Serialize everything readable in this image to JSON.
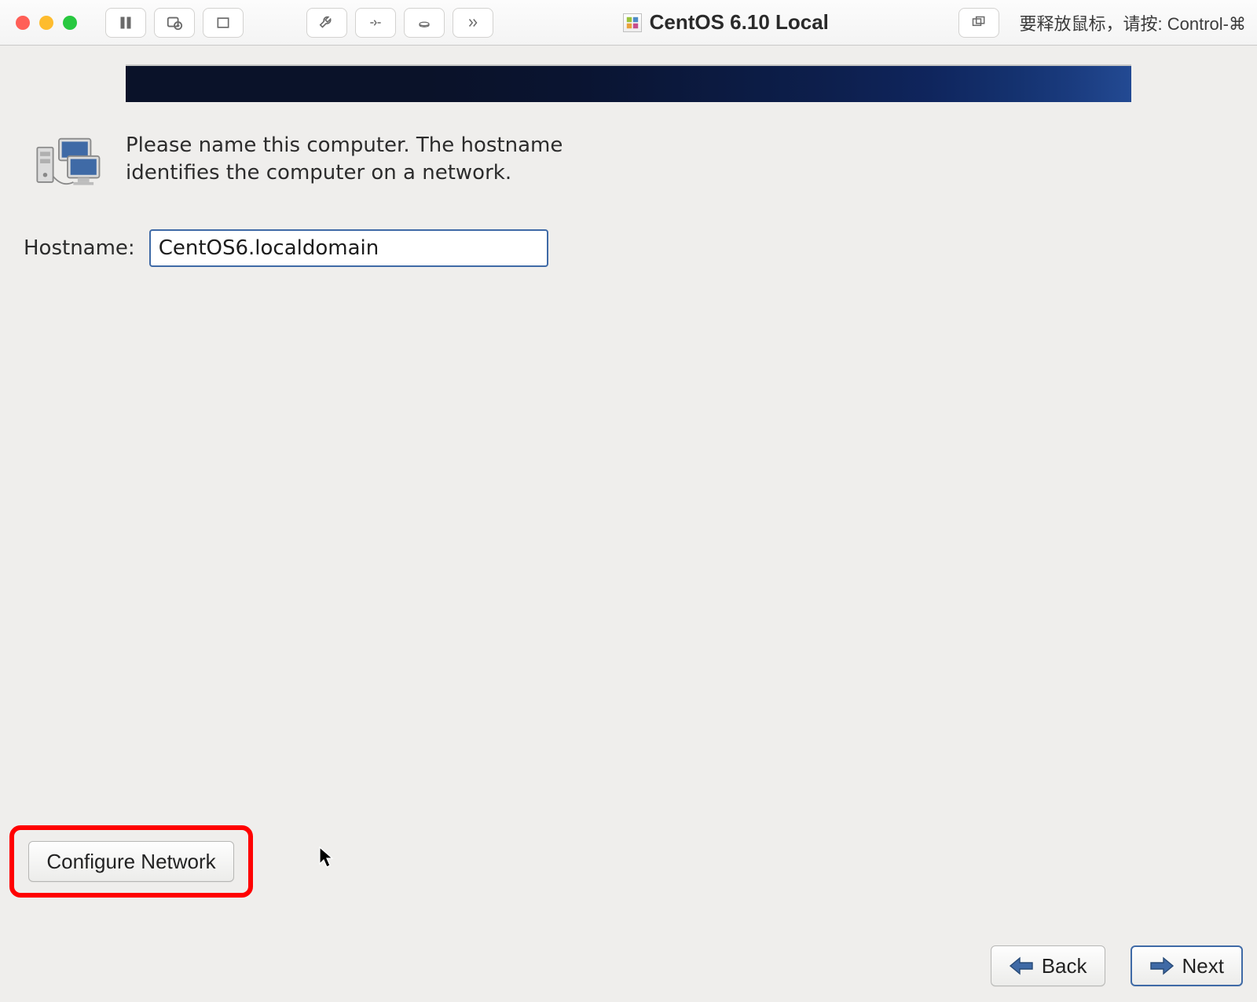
{
  "title": {
    "vm_name": "CentOS 6.10 Local",
    "release_hint": "要释放鼠标，请按: Control-⌘"
  },
  "installer": {
    "intro_text": "Please name this computer.  The hostname identifies the computer on a network.",
    "hostname_label": "Hostname:",
    "hostname_value": "CentOS6.localdomain",
    "configure_network_label": "Configure Network",
    "back_label": "Back",
    "next_label": "Next"
  },
  "toolbar": {
    "icons": {
      "pause": "pause-icon",
      "snapshot": "camera-snapshot-icon",
      "fullscreen": "rectangle-icon",
      "tools": "wrench-icon",
      "shortcut": "send-key-icon",
      "disk": "disk-icon",
      "more": "chevrons-right-icon",
      "windows": "window-stack-icon"
    }
  }
}
